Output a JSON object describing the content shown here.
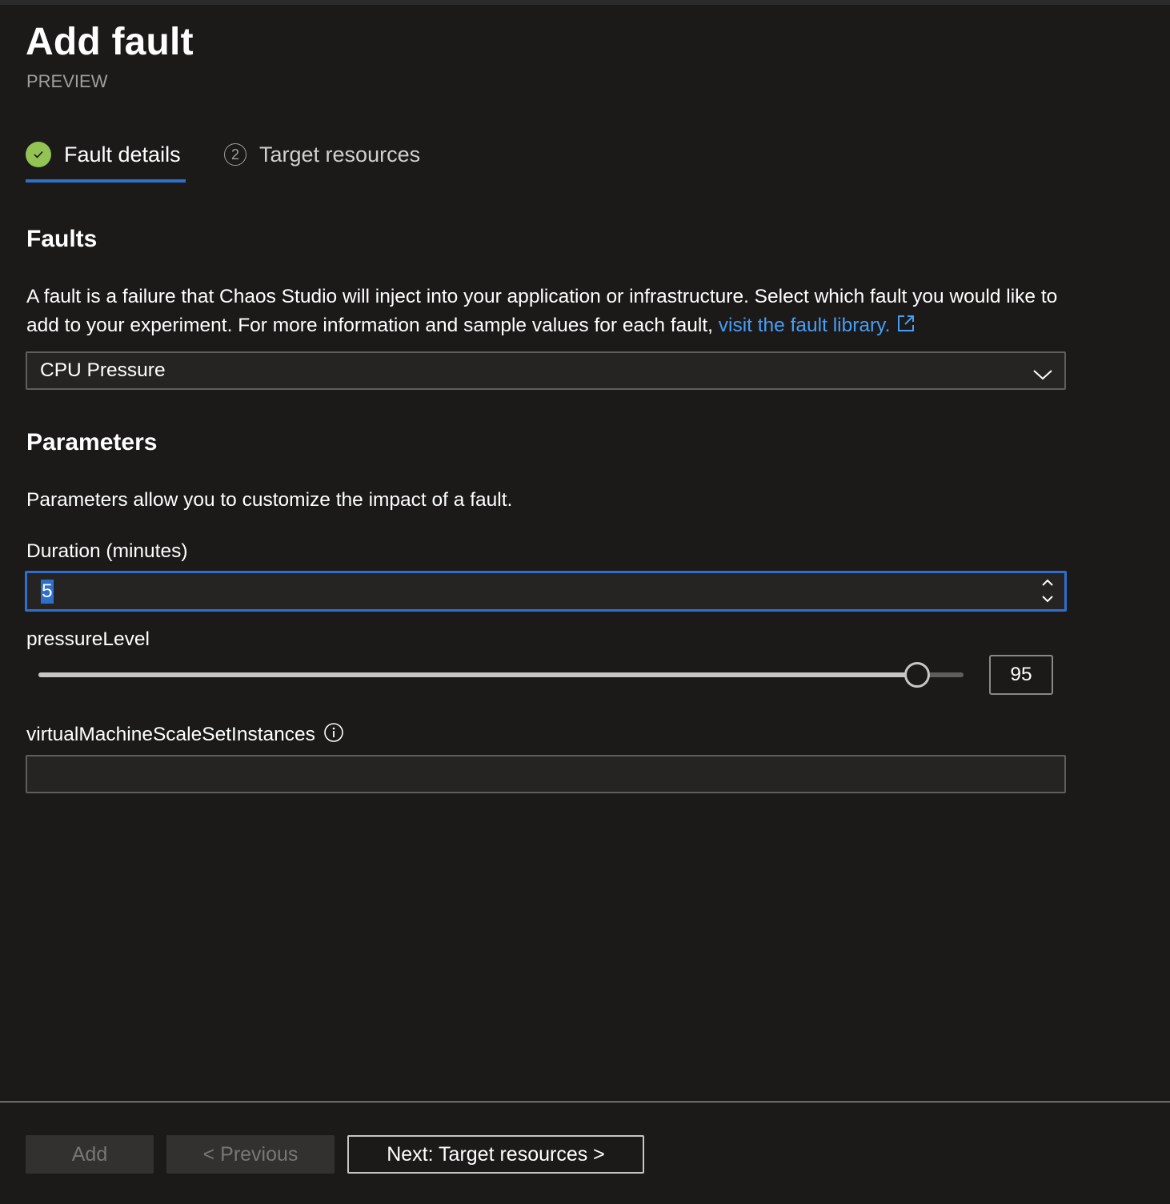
{
  "panel": {
    "title": "Add fault",
    "subtitle": "PREVIEW"
  },
  "tabs": [
    {
      "label": "Fault details",
      "state": "completed",
      "active": true
    },
    {
      "label": "Target resources",
      "number": "2",
      "active": false
    }
  ],
  "faults": {
    "heading": "Faults",
    "description": "A fault is a failure that Chaos Studio will inject into your application or infrastructure. Select which fault you would like to add to your experiment. For more information and sample values for each fault, ",
    "link_text": "visit the fault library.",
    "selected_fault": "CPU Pressure"
  },
  "parameters": {
    "heading": "Parameters",
    "description": "Parameters allow you to customize the impact of a fault.",
    "duration": {
      "label": "Duration (minutes)",
      "value": "5"
    },
    "pressure_level": {
      "label": "pressureLevel",
      "value": 95,
      "min": 0,
      "max": 100,
      "display_value": "95"
    },
    "vmss_instances": {
      "label": "virtualMachineScaleSetInstances",
      "value": ""
    }
  },
  "footer": {
    "add_label": "Add",
    "previous_label": "< Previous",
    "next_label": "Next: Target resources >"
  },
  "colors": {
    "background": "#1b1a19",
    "accent": "#2f6fcb",
    "link": "#479ef5",
    "success": "#92c353"
  }
}
